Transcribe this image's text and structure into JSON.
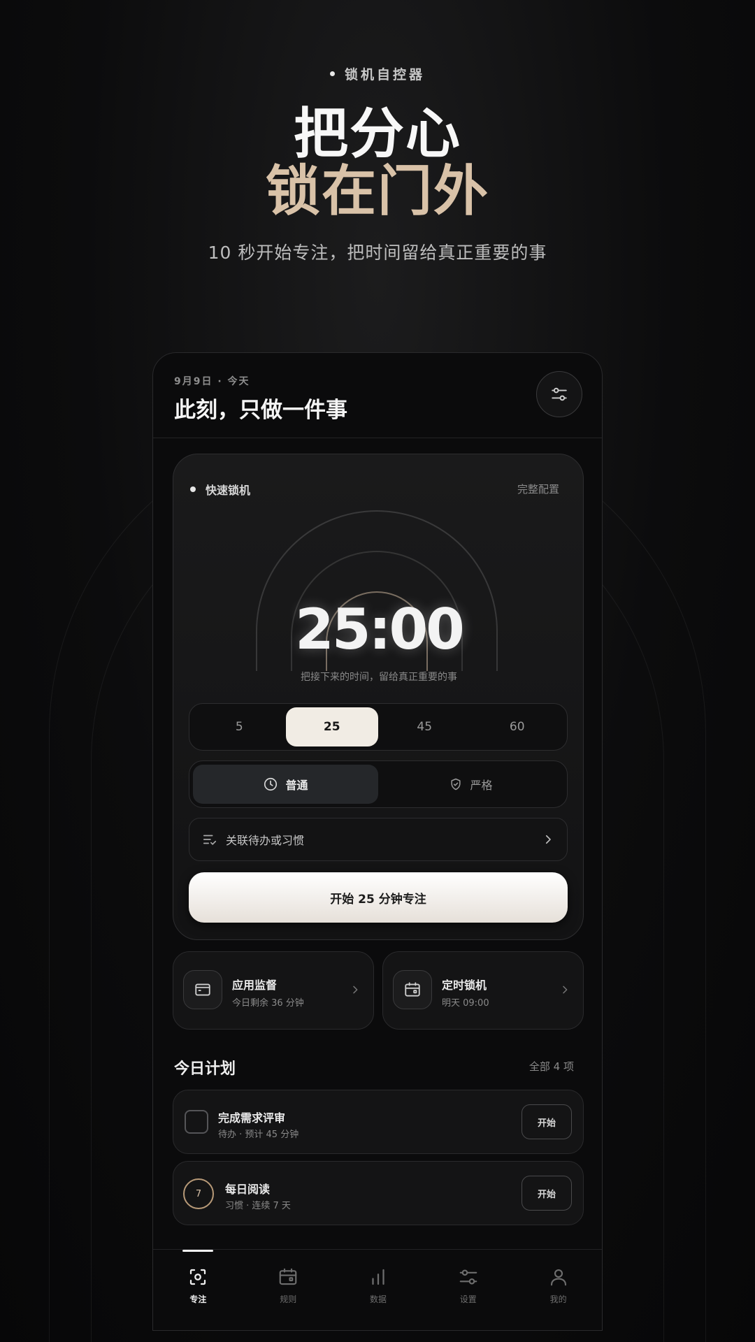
{
  "hero": {
    "badge": "锁机自控器",
    "title_line1": "把分心",
    "title_line2": "锁在门外",
    "subtitle": "10 秒开始专注，把时间留给真正重要的事"
  },
  "header": {
    "date": "9月9日 · 今天",
    "title": "此刻，只做一件事",
    "filter_icon": "sliders-icon"
  },
  "quick_lock": {
    "label": "快速锁机",
    "config_link": "完整配置",
    "timer": "25:00",
    "timer_caption": "把接下来的时间，留给真正重要的事",
    "durations": [
      "5",
      "25",
      "45",
      "60"
    ],
    "selected_duration": "25",
    "modes": [
      {
        "label": "普通",
        "icon": "clock-icon",
        "active": true
      },
      {
        "label": "严格",
        "icon": "shield-icon",
        "active": false
      }
    ],
    "link_todo": "关联待办或习惯",
    "start_button": "开始 25 分钟专注"
  },
  "shortcuts": [
    {
      "title": "应用监督",
      "subtitle": "今日剩余 36 分钟",
      "icon": "app-window-icon"
    },
    {
      "title": "定时锁机",
      "subtitle": "明天 09:00",
      "icon": "calendar-icon"
    }
  ],
  "plan": {
    "title": "今日计划",
    "all_link": "全部 4 项",
    "tasks": [
      {
        "title": "完成需求评审",
        "subtitle": "待办 · 预计 45 分钟",
        "button": "开始"
      },
      {
        "title": "每日阅读",
        "subtitle": "习惯 · 连续 7 天",
        "button": "开始",
        "badge": "7"
      }
    ]
  },
  "tabs": [
    {
      "label": "专注",
      "icon": "focus-icon",
      "active": true
    },
    {
      "label": "规则",
      "icon": "calendar-icon",
      "active": false
    },
    {
      "label": "数据",
      "icon": "bar-chart-icon",
      "active": false
    },
    {
      "label": "设置",
      "icon": "sliders-icon",
      "active": false
    },
    {
      "label": "我的",
      "icon": "user-icon",
      "active": false
    }
  ],
  "colors": {
    "accent": "#d9c2a8",
    "background": "#0b0b0c",
    "active_chip": "#f1ece4"
  }
}
